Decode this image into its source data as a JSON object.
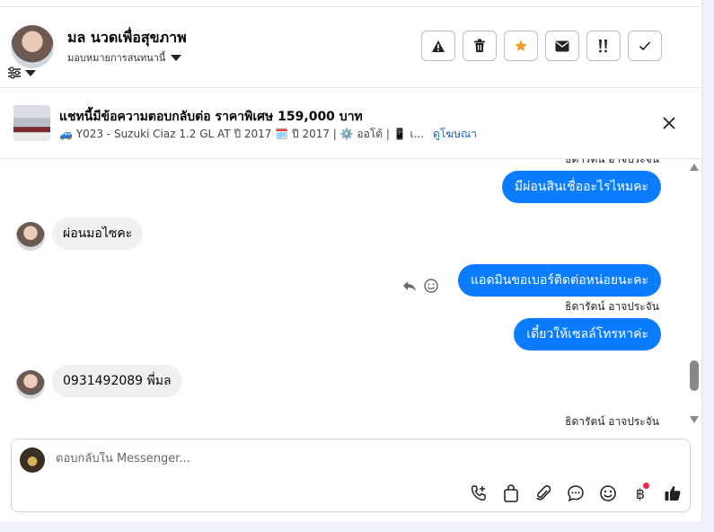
{
  "header": {
    "contact_name": "มล นวดเพื่อสุขภาพ",
    "assign_label": "มอบหมายการสนทนานี้",
    "actions": [
      {
        "name": "report-button",
        "icon": "warning-icon"
      },
      {
        "name": "delete-button",
        "icon": "trash-icon"
      },
      {
        "name": "star-button",
        "icon": "star-icon",
        "color": "#f59b23"
      },
      {
        "name": "mark-unread-button",
        "icon": "envelope-icon"
      },
      {
        "name": "spam-button",
        "icon": "spam-icon"
      },
      {
        "name": "done-button",
        "icon": "checkmark-icon"
      }
    ]
  },
  "ad": {
    "title": "แชทนี้มีข้อความตอบกลับต่อ ราคาพิเศษ 159,000 บาท",
    "subtitle": "🚙 Y023 - Suzuki Ciaz 1.2 GL AT ปี 2017 🗓️ ปี 2017 | ⚙️ ออโต้ | 📱 เ...",
    "link": "ดูโฆษณา"
  },
  "messages": {
    "top_sender_partial": "ธิดารัตน์ อาจประจัน",
    "out1": "มีผ่อนสินเชื่ออะไรไหมคะ",
    "in1": "ผ่อนมอไซคะ",
    "out2": "แอดมินขอเบอร์ติดต่อหน่อยนะคะ",
    "sender2": "ธิดารัตน์ อาจประจัน",
    "out3": "เดี๋ยวให้เซลล์โทรหาค่ะ",
    "in2": "0931492089 พี่มล",
    "sender3": "ธิดารัตน์ อาจประจัน"
  },
  "composer": {
    "placeholder": "ตอบกลับใน Messenger...",
    "tools": [
      "call-add-icon",
      "shopping-bag-icon",
      "paperclip-icon",
      "chat-bubble-icon",
      "emoji-icon",
      "baht-icon",
      "thumbs-up-icon"
    ],
    "baht_symbol": "฿"
  },
  "colors": {
    "accent": "#0a7cff",
    "link": "#1565c0",
    "notification": "#f02849"
  }
}
